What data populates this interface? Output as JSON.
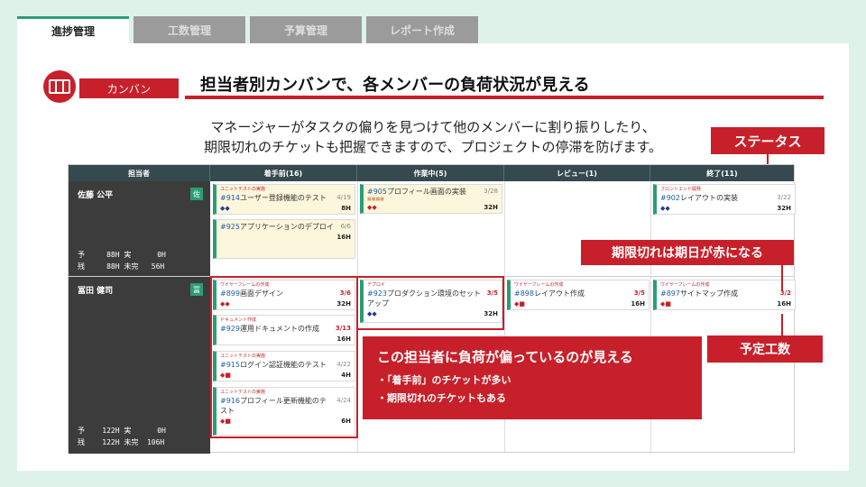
{
  "tabs": [
    "進捗管理",
    "工数管理",
    "予算管理",
    "レポート作成"
  ],
  "header": {
    "pill": "カンバン",
    "title": "担当者別カンバンで、各メンバーの負荷状況が見える"
  },
  "description": {
    "line1": "マネージャーがタスクの偏りを見つけて他のメンバーに割り振りしたり、",
    "line2": "期限切れのチケットも把握できますので、プロジェクトの停滞を防げます。"
  },
  "callouts": {
    "status": "ステータス",
    "overdue": "期限切れは期日が赤になる",
    "estimate": "予定工数",
    "load_title": "この担当者に負荷が偏っているのが見える",
    "load_item1": "・「着手前」のチケットが多い",
    "load_item2": "・期限切れのチケットもある"
  },
  "board": {
    "columns": [
      "担当者",
      "着手前(16)",
      "作業中(5)",
      "レビュー(1)",
      "終了(11)"
    ],
    "members": [
      {
        "name": "佐藤 公平",
        "badge": "佐",
        "stats": "予     88H 実      0H\n残     88H 未完   56H"
      },
      {
        "name": "冨田 健司",
        "badge": "冨",
        "stats": "予    122H 実      0H\n残    122H 未完  106H"
      }
    ],
    "cards": {
      "c1": {
        "cat": "ユニットテストの実施",
        "num": "#914",
        "title": "ユーザー登録機能のテスト",
        "due": "4/19",
        "est": "8H"
      },
      "c2": {
        "cat": "",
        "num": "#925",
        "title": "アプリケーションのデプロイ",
        "due": "6/6",
        "est": "16H"
      },
      "c3": {
        "cat": "",
        "num": "#905",
        "title": "プロフィール画面の実装",
        "due": "3/28",
        "est": "32H"
      },
      "c4": {
        "cat": "フロントエンド開発",
        "num": "#902",
        "title": "レイアウトの実装",
        "due": "3/22",
        "est": "32H"
      },
      "c5": {
        "cat": "ワイヤーフレームの作成",
        "num": "#899",
        "title": "画面デザイン",
        "due": "3/6",
        "est": "32H"
      },
      "c6": {
        "cat": "ドキュメント作成",
        "num": "#929",
        "title": "運用ドキュメントの作成",
        "due": "3/13",
        "est": "16H"
      },
      "c7": {
        "cat": "ユニットテストの実施",
        "num": "#915",
        "title": "ログイン認証機能のテスト",
        "due": "4/22",
        "est": "4H"
      },
      "c8": {
        "cat": "ユニットテストの実施",
        "num": "#916",
        "title": "プロフィール更新機能のテスト",
        "due": "4/24",
        "est": "6H"
      },
      "c9": {
        "cat": "デプロイ",
        "num": "#923",
        "title": "プロダクション環境のセットアップ",
        "due": "3/5",
        "est": "32H"
      },
      "c10": {
        "cat": "ワイヤーフレームの作成",
        "num": "#898",
        "title": "レイアウト作成",
        "due": "3/5",
        "est": "16H"
      },
      "c11": {
        "cat": "ワイヤーフレームの作成",
        "num": "#897",
        "title": "サイトマップ作成",
        "due": "3/2",
        "est": "16H"
      }
    }
  }
}
